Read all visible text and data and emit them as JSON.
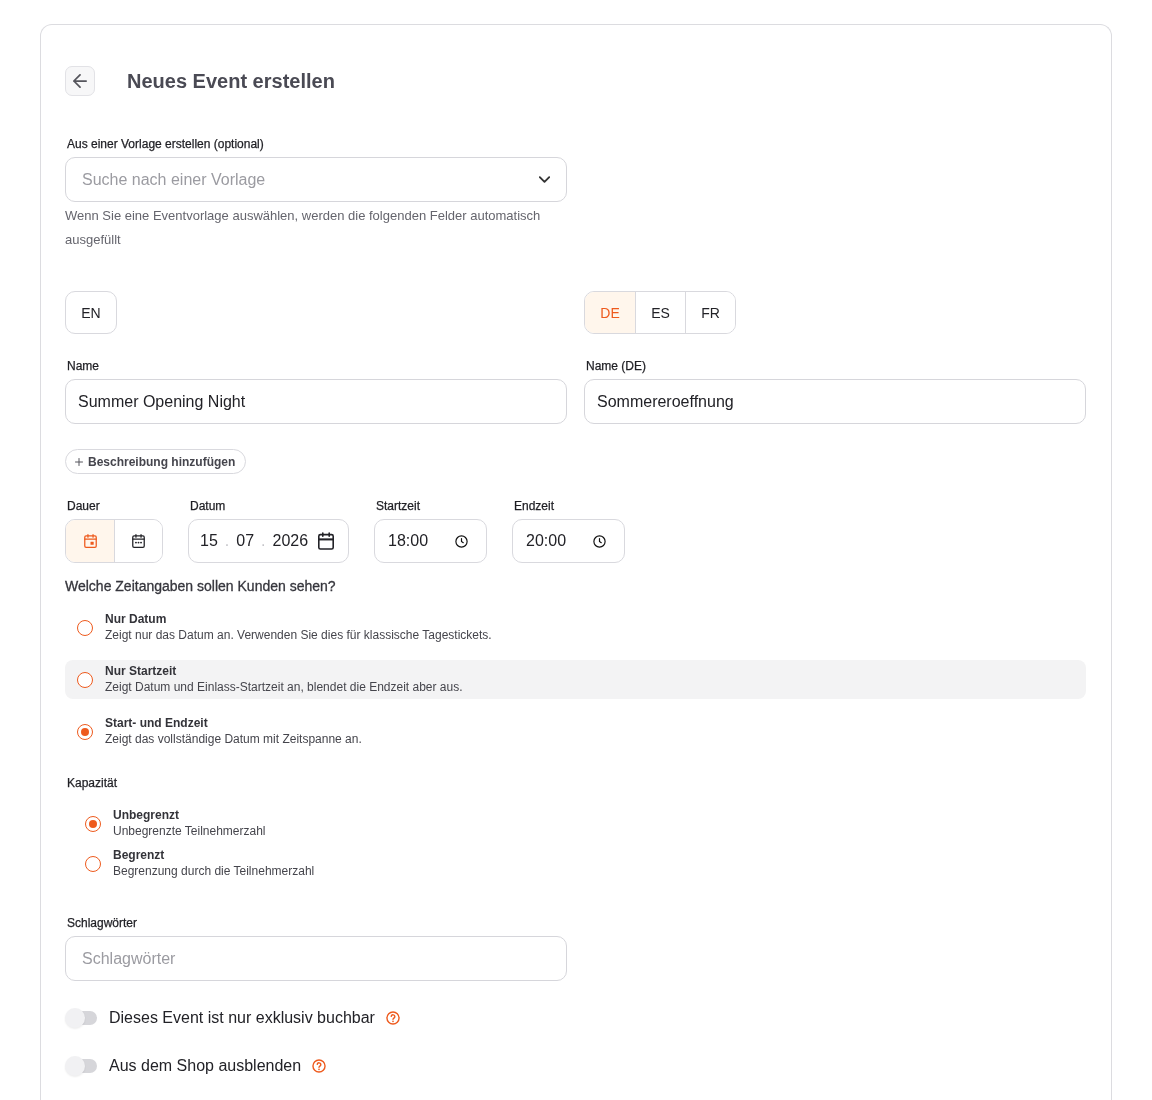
{
  "header": {
    "title": "Neues Event erstellen"
  },
  "template": {
    "label": "Aus einer Vorlage erstellen (optional)",
    "placeholder": "Suche nach einer Vorlage",
    "hint": "Wenn Sie eine Eventvorlage auswählen, werden die folgenden Felder automatisch ausgefüllt"
  },
  "languages": {
    "primary": [
      {
        "label": "EN",
        "selected": false
      }
    ],
    "translations": [
      {
        "label": "DE",
        "selected": true
      },
      {
        "label": "ES",
        "selected": false
      },
      {
        "label": "FR",
        "selected": false
      }
    ]
  },
  "name_fields": [
    {
      "label": "Name",
      "value": "Summer Opening Night"
    },
    {
      "label": "Name (DE)",
      "value": "Sommereroeffnung"
    }
  ],
  "add_description": {
    "label": "Beschreibung hinzufügen"
  },
  "schedule": {
    "duration": {
      "label": "Dauer",
      "options": [
        {
          "kind": "single-day",
          "selected": true
        },
        {
          "kind": "multi-day",
          "selected": false
        }
      ]
    },
    "date": {
      "label": "Datum",
      "day": "15",
      "month": "07",
      "year": "2026",
      "separators": [
        ".",
        "."
      ]
    },
    "start_time": {
      "label": "Startzeit",
      "value": "18:00"
    },
    "end_time": {
      "label": "Endzeit",
      "value": "20:00"
    }
  },
  "time_display": {
    "question": "Welche Zeitangaben sollen Kunden sehen?",
    "options": [
      {
        "title": "Nur Datum",
        "description": "Zeigt nur das Datum an. Verwenden Sie dies für klassische Tagestickets.",
        "selected": false,
        "hovered": false
      },
      {
        "title": "Nur Startzeit",
        "description": "Zeigt Datum und Einlass-Startzeit an, blendet die Endzeit aber aus.",
        "selected": false,
        "hovered": true
      },
      {
        "title": "Start- und Endzeit",
        "description": "Zeigt das vollständige Datum mit Zeitspanne an.",
        "selected": true,
        "hovered": false
      }
    ]
  },
  "capacity": {
    "label": "Kapazität",
    "options": [
      {
        "title": "Unbegrenzt",
        "description": "Unbegrenzte Teilnehmerzahl",
        "selected": true
      },
      {
        "title": "Begrenzt",
        "description": "Begrenzung durch die Teilnehmerzahl",
        "selected": false
      }
    ]
  },
  "tags": {
    "label": "Schlagwörter",
    "placeholder": "Schlagwörter"
  },
  "toggles": [
    {
      "label": "Dieses Event ist nur exklusiv buchbar",
      "on": false
    },
    {
      "label": "Aus dem Shop ausblenden",
      "on": false
    }
  ]
}
